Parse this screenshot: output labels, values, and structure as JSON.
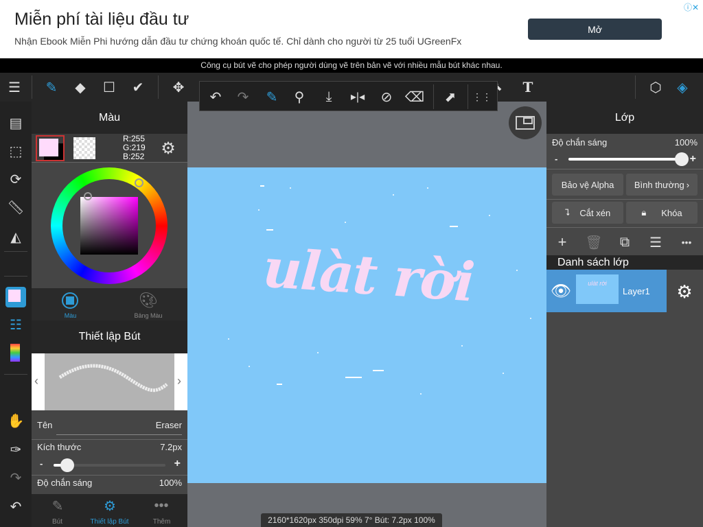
{
  "ad": {
    "title": "Miễn phí tài liệu đầu tư",
    "subtitle": "Nhận Ebook Miễn Phi hướng dẫn đầu tư chứng khoán quốc tế. Chỉ dành cho người từ 25 tuổi UGreenFx",
    "button": "Mở"
  },
  "tooltip": "Công cụ bút vẽ cho phép người dùng vẽ trên bản vẽ với nhiều mẫu bút khác nhau.",
  "toolbar": {
    "text_tool": "T"
  },
  "color_panel": {
    "title": "Màu",
    "r": "R:255",
    "g": "G:219",
    "b": "B:252",
    "foreground": "#ffdbfc",
    "tab_color": "Màu",
    "tab_palette": "Bảng Màu"
  },
  "brush_panel": {
    "title": "Thiết lập Bút",
    "name_label": "Tên",
    "name_value": "Eraser",
    "size_label": "Kích thước",
    "size_value": "7.2px",
    "size_fraction": 0.12,
    "opacity_label": "Độ chắn sáng",
    "opacity_value": "100%",
    "minus": "-",
    "plus": "+"
  },
  "bottom_tabs": {
    "brush": "Bút",
    "brush_settings": "Thiết lập Bút",
    "more": "Thêm"
  },
  "canvas": {
    "artwork_text": "ulàt rời",
    "background": "#80c8f9",
    "stroke": "#f8d8f4"
  },
  "layer_panel": {
    "title": "Lớp",
    "opacity_label": "Độ chắn sáng",
    "opacity_value": "100%",
    "opacity_fraction": 1.0,
    "minus": "-",
    "plus": "+",
    "alpha_protect": "Bảo vệ Alpha",
    "blend_mode": "Bình thường",
    "clip": "Cắt xén",
    "lock": "Khóa",
    "list_title": "Danh sách lớp",
    "layers": [
      {
        "name": "Layer1",
        "visible": true,
        "thumb_text": "ulàt rời"
      }
    ]
  },
  "status": "2160*1620px 350dpi 59% 7° Bút: 7.2px 100%",
  "accent": "#2e9bd6"
}
